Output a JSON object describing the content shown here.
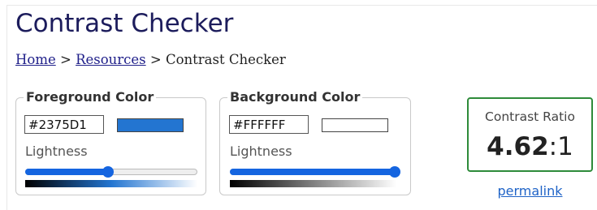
{
  "page": {
    "title": "Contrast Checker",
    "breadcrumb": {
      "home": "Home",
      "separator_1": ">",
      "resources": "Resources",
      "separator_2": ">",
      "current": "Contrast Checker"
    }
  },
  "foreground": {
    "legend": "Foreground Color",
    "hex_value": "#2375D1",
    "swatch_color": "#2375D1",
    "lightness_label": "Lightness",
    "lightness_fraction": 0.48,
    "track_fill_color": "#1565e0",
    "gradient_stops": [
      "#000000",
      "#2375D1",
      "#ffffff"
    ]
  },
  "background": {
    "legend": "Background Color",
    "hex_value": "#FFFFFF",
    "swatch_color": "#FFFFFF",
    "lightness_label": "Lightness",
    "lightness_fraction": 1.0,
    "track_fill_color": "#1565e0",
    "gradient_stops": [
      "#000000",
      "#808080",
      "#ffffff"
    ]
  },
  "result": {
    "label": "Contrast Ratio",
    "ratio": "4.62",
    "suffix": ":1",
    "border_color": "#2e8b3a"
  },
  "links": {
    "permalink": "permalink"
  }
}
